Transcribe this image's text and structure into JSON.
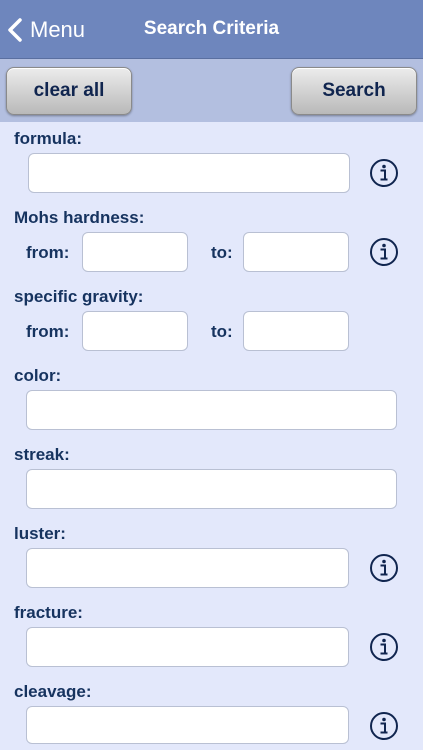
{
  "nav": {
    "back_label": "Menu",
    "title": "Search Criteria"
  },
  "toolbar": {
    "clear_label": "clear all",
    "search_label": "Search"
  },
  "form": {
    "formula": {
      "label": "formula:",
      "value": ""
    },
    "mohs": {
      "label": "Mohs hardness:",
      "from_label": "from:",
      "to_label": "to:",
      "from_value": "",
      "to_value": ""
    },
    "gravity": {
      "label": "specific gravity:",
      "from_label": "from:",
      "to_label": "to:",
      "from_value": "",
      "to_value": ""
    },
    "color": {
      "label": "color:",
      "value": ""
    },
    "streak": {
      "label": "streak:",
      "value": ""
    },
    "luster": {
      "label": "luster:",
      "value": ""
    },
    "fracture": {
      "label": "fracture:",
      "value": ""
    },
    "cleavage": {
      "label": "cleavage:",
      "value": ""
    }
  },
  "icons": {
    "back": "chevron-left-icon",
    "info": "info-icon"
  },
  "colors": {
    "navbar": "#6e86bd",
    "toolbar": "#b3bfe0",
    "background": "#e3e8fb",
    "label": "#16335f"
  }
}
